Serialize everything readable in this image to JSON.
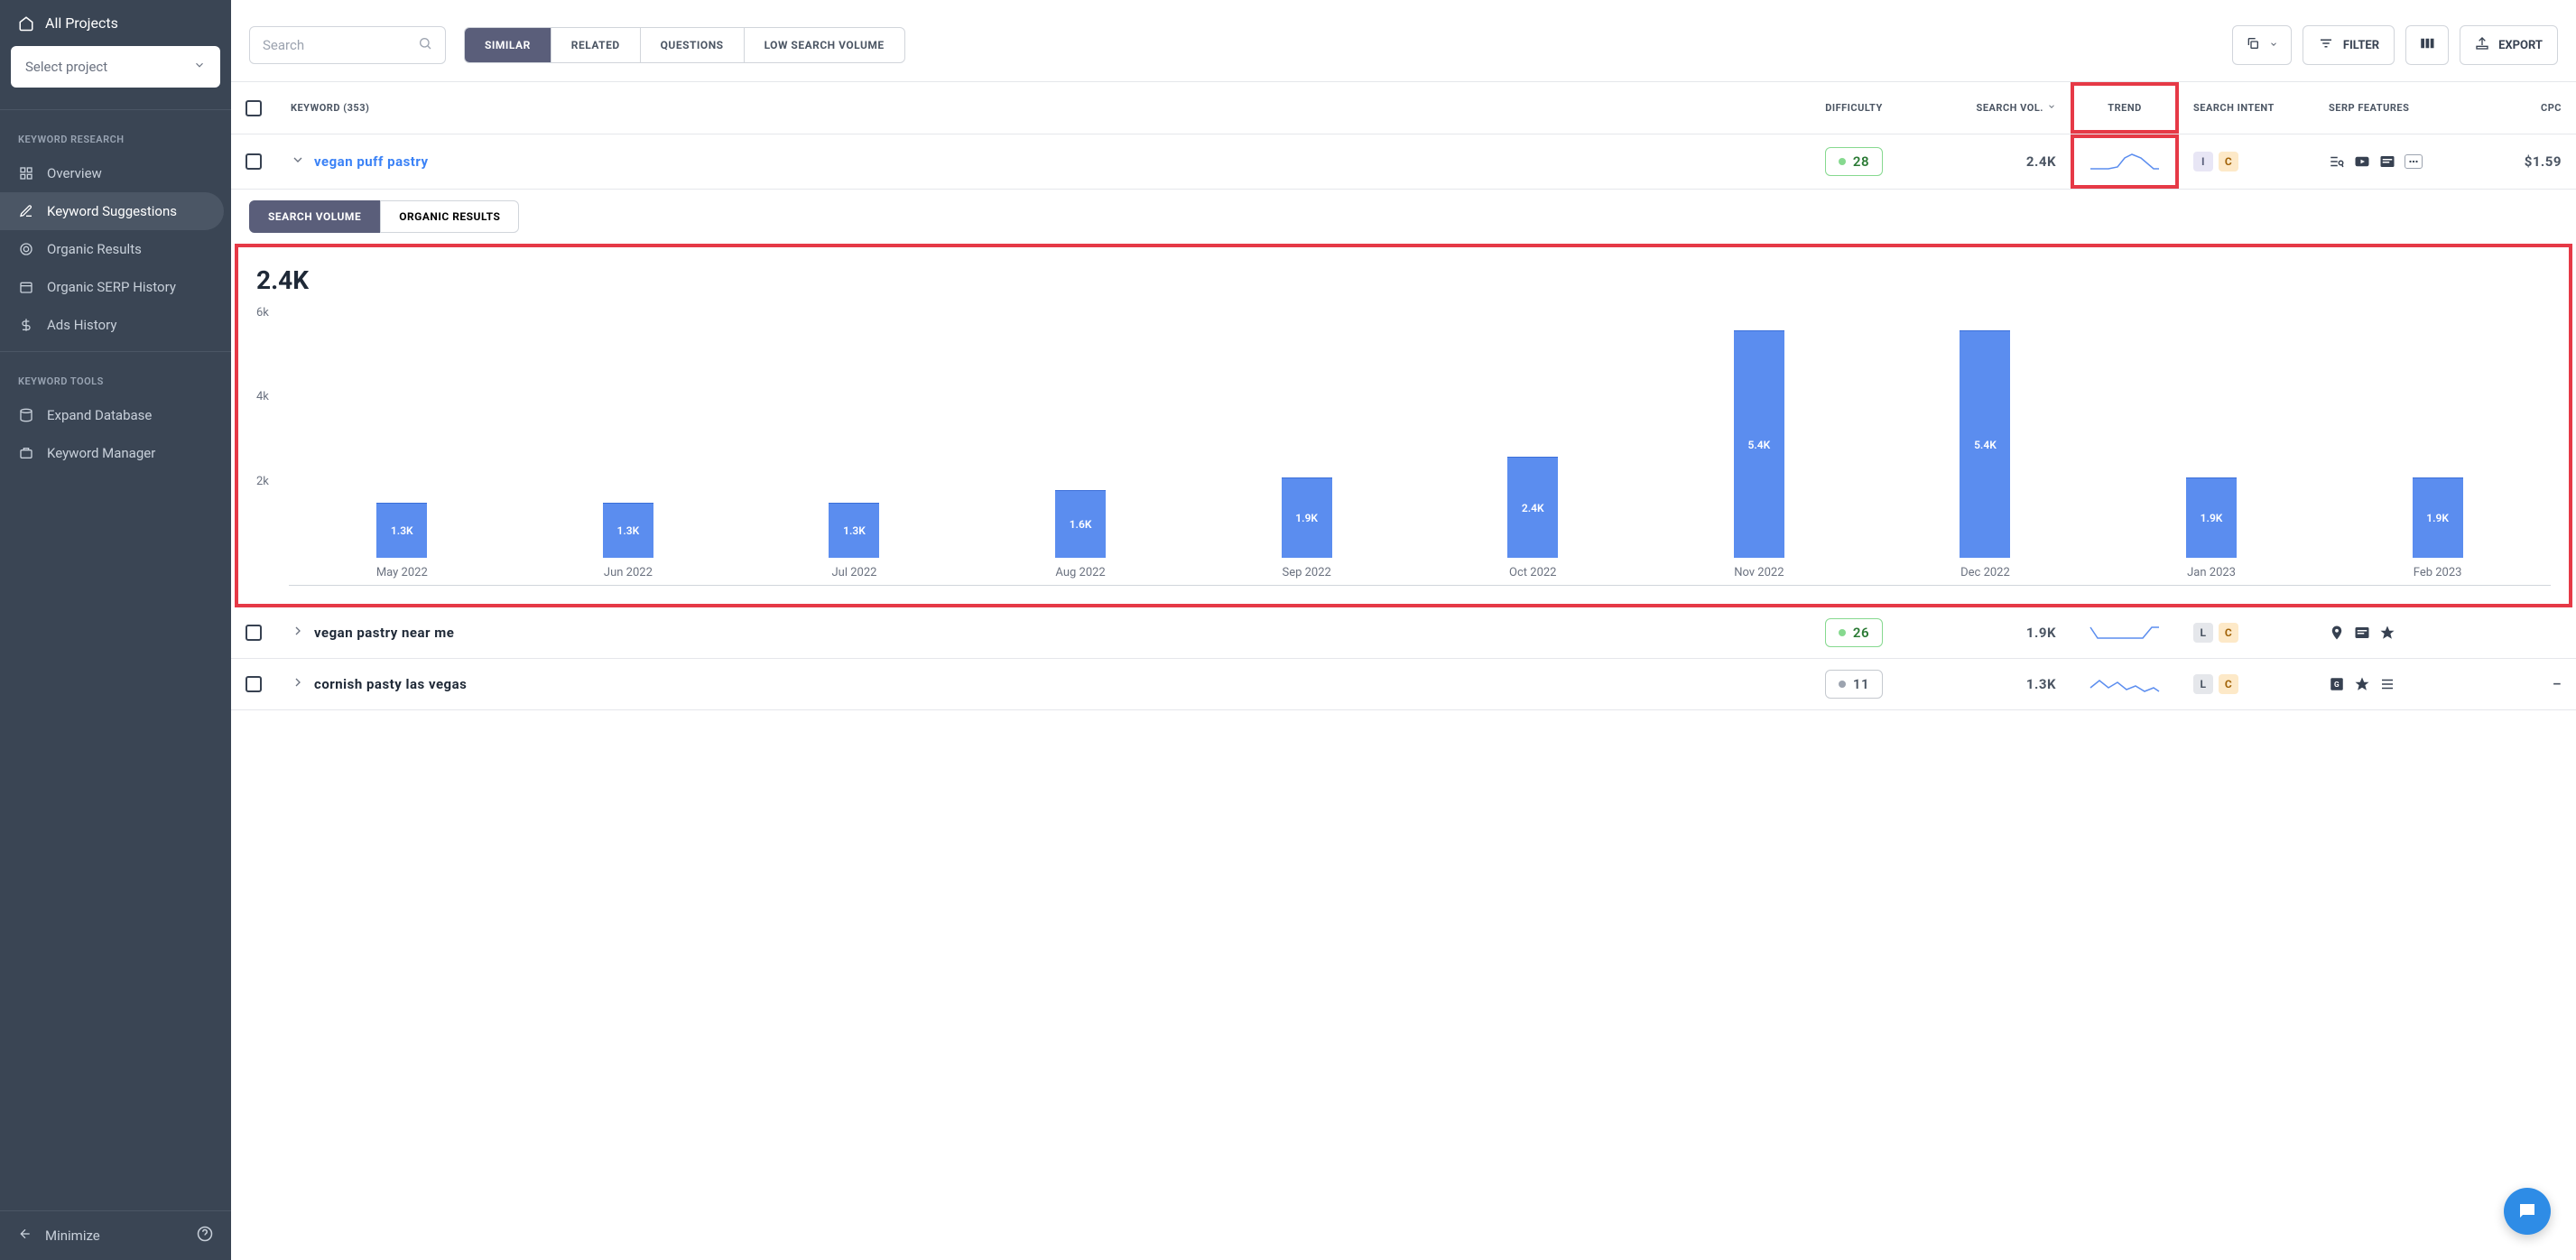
{
  "sidebar": {
    "all_projects": "All Projects",
    "select_project": "Select project",
    "sections": {
      "research": "KEYWORD RESEARCH",
      "tools": "KEYWORD TOOLS"
    },
    "items": {
      "overview": "Overview",
      "suggestions": "Keyword Suggestions",
      "organic_results": "Organic Results",
      "serp_history": "Organic SERP History",
      "ads_history": "Ads History",
      "expand_db": "Expand Database",
      "kw_manager": "Keyword Manager"
    },
    "minimize": "Minimize"
  },
  "toolbar": {
    "search_placeholder": "Search",
    "tabs": {
      "similar": "SIMILAR",
      "related": "RELATED",
      "questions": "QUESTIONS",
      "low_volume": "LOW SEARCH VOLUME"
    },
    "filter": "FILTER",
    "export": "EXPORT"
  },
  "table": {
    "headers": {
      "keyword": "KEYWORD",
      "count": "(353)",
      "difficulty": "DIFFICULTY",
      "volume": "SEARCH VOL.",
      "trend": "TREND",
      "intent": "SEARCH INTENT",
      "serp": "SERP FEATURES",
      "cpc": "CPC"
    },
    "rows": [
      {
        "keyword": "vegan puff pastry",
        "difficulty": "28",
        "diff_class": "green",
        "volume": "2.4K",
        "intents": [
          "I",
          "C"
        ],
        "cpc": "$1.59",
        "expanded": true
      },
      {
        "keyword": "vegan pastry near me",
        "difficulty": "26",
        "diff_class": "green",
        "volume": "1.9K",
        "intents": [
          "L",
          "C"
        ],
        "cpc": "",
        "expanded": false
      },
      {
        "keyword": "cornish pasty las vegas",
        "difficulty": "11",
        "diff_class": "gray",
        "volume": "1.3K",
        "intents": [
          "L",
          "C"
        ],
        "cpc": "–",
        "expanded": false
      }
    ]
  },
  "expand": {
    "tabs": {
      "volume": "SEARCH VOLUME",
      "organic": "ORGANIC RESULTS"
    },
    "chart_value": "2.4K"
  },
  "chart_data": {
    "type": "bar",
    "title": "2.4K",
    "ylabel": "",
    "xlabel": "",
    "ylim": [
      0,
      6000
    ],
    "yticks": [
      "6k",
      "4k",
      "2k"
    ],
    "categories": [
      "May 2022",
      "Jun 2022",
      "Jul 2022",
      "Aug 2022",
      "Sep 2022",
      "Oct 2022",
      "Nov 2022",
      "Dec 2022",
      "Jan 2023",
      "Feb 2023"
    ],
    "values": [
      1300,
      1300,
      1300,
      1600,
      1900,
      2400,
      5400,
      5400,
      1900,
      1900
    ],
    "labels": [
      "1.3K",
      "1.3K",
      "1.3K",
      "1.6K",
      "1.9K",
      "2.4K",
      "5.4K",
      "5.4K",
      "1.9K",
      "1.9K"
    ]
  }
}
